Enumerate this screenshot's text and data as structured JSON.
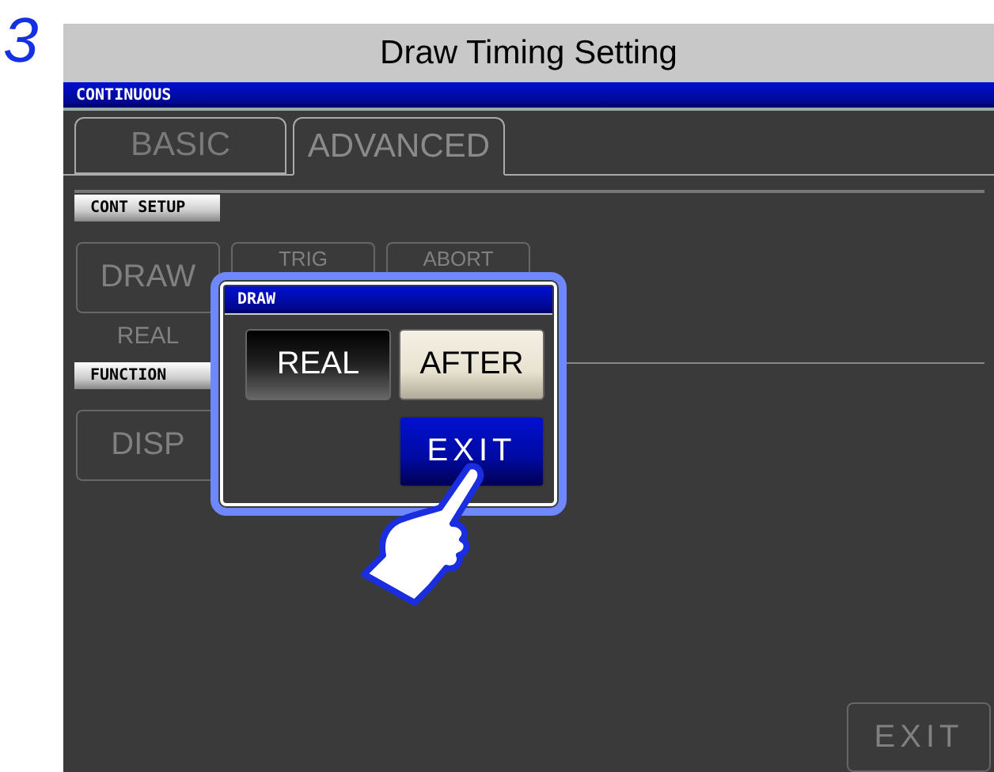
{
  "step": "3",
  "title": "Draw Timing Setting",
  "header": "CONTINUOUS",
  "tabs": [
    {
      "label": "BASIC",
      "selected": false
    },
    {
      "label": "ADVANCED",
      "selected": true
    }
  ],
  "sections": [
    {
      "label": "CONT SETUP",
      "buttons": [
        {
          "label": "DRAW",
          "value": "REAL"
        },
        {
          "label": "TRIG"
        },
        {
          "label": "ABORT"
        }
      ]
    },
    {
      "label": "FUNCTION",
      "buttons": [
        {
          "label": "DISP"
        }
      ]
    }
  ],
  "exit": "EXIT",
  "dialog": {
    "title": "DRAW",
    "options": [
      {
        "label": "REAL",
        "selected": true
      },
      {
        "label": "AFTER",
        "selected": false
      }
    ],
    "exit": "EXIT"
  }
}
